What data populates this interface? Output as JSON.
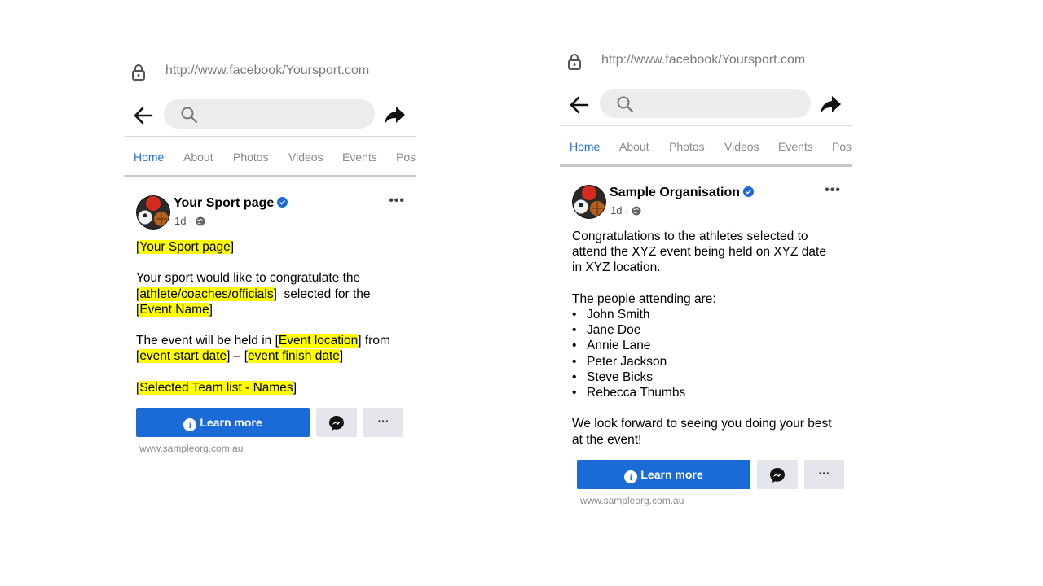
{
  "left": {
    "url": "http://www.facebook/Yoursport.com",
    "tabs": [
      "Home",
      "About",
      "Photos",
      "Videos",
      "Events",
      "Pos"
    ],
    "page_name": "Your Sport page",
    "post_age": "1d ·",
    "body": {
      "line1": {
        "pre": "[",
        "hl": "Your Sport page",
        "post": "]"
      },
      "line2": "Your sport would like to congratulate the",
      "line3": {
        "pre": "[",
        "hl": "athlete/coaches/officials",
        "post": "]  selected for the"
      },
      "line4": {
        "pre": "[",
        "hl": "Event Name",
        "post": "]"
      },
      "line5": {
        "pre": "The event will be held in [",
        "hl": "Event location",
        "post": "] from"
      },
      "line6": {
        "pre": "[",
        "hl1": "event start date",
        "mid": "] – [",
        "hl2": "event finish date",
        "post": "]"
      },
      "line7": {
        "pre": "[",
        "hl": "Selected Team list - Names",
        "post": "]"
      }
    },
    "learn_more": "Learn more",
    "more": "···",
    "website": "www.sampleorg.com.au"
  },
  "right": {
    "url": "http://www.facebook/Yoursport.com",
    "tabs": [
      "Home",
      "About",
      "Photos",
      "Videos",
      "Events",
      "Pos"
    ],
    "page_name": "Sample Organisation",
    "post_age": "1d ·",
    "body": {
      "para1": [
        "Congratulations to the athletes selected to",
        "attend the XYZ event being held on XYZ date",
        "in XYZ location."
      ],
      "attending": "The people attending are:",
      "people": [
        "John Smith",
        "Jane Doe",
        "Annie Lane",
        "Peter Jackson",
        "Steve Bicks",
        "Rebecca Thumbs"
      ],
      "closing": [
        "We look forward to seeing you doing your best",
        "at the event!"
      ]
    },
    "learn_more": "Learn more",
    "more": "···",
    "website": "www.sampleorg.com.au"
  },
  "icons": {
    "lock": "lock-icon",
    "back": "back-arrow-icon",
    "search": "search-icon",
    "share": "share-icon",
    "verified": "verified-badge-icon",
    "globe": "globe-icon",
    "info": "info-icon",
    "messenger": "messenger-icon",
    "more": "more-dots-icon"
  },
  "colors": {
    "accent": "#1b6bd6",
    "highlight": "#ffff00",
    "tab_active": "#1a6fd8"
  }
}
